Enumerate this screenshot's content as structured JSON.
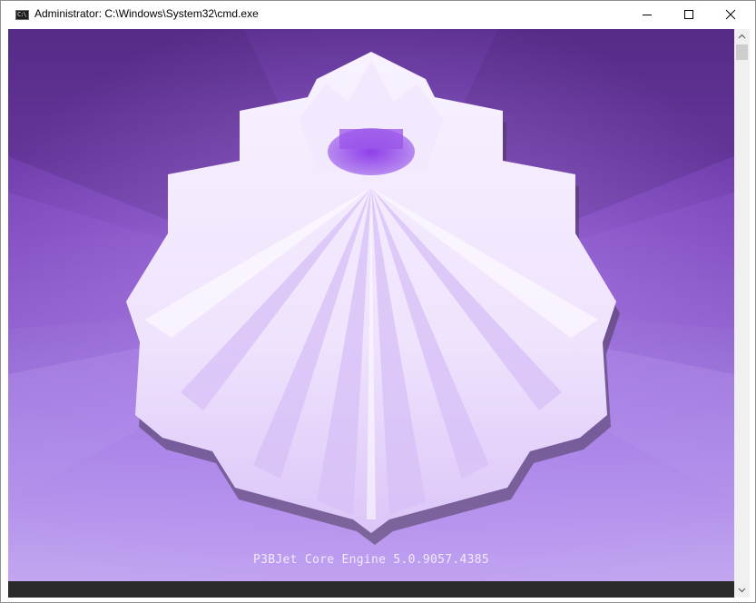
{
  "window": {
    "title": "Administrator: C:\\Windows\\System32\\cmd.exe",
    "icon_text": "C:\\",
    "controls": {
      "minimize": "minimize-icon",
      "maximize": "maximize-icon",
      "close": "close-icon"
    }
  },
  "console": {
    "status_line": "P3BJet Core Engine 5.0.9057.4385",
    "colors": {
      "background_dark": "#5a2f8c",
      "background_light": "#c3a6f0",
      "emblem_light": "#f6eefe",
      "emblem_core": "#9a55e6",
      "bottom_strip": "#2b2b2b"
    }
  },
  "scrollbar": {
    "up_icon": "chevron-up-icon",
    "down_icon": "chevron-down-icon"
  }
}
